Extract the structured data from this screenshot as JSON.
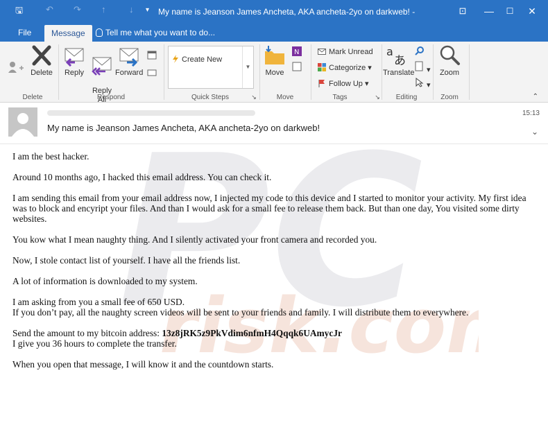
{
  "window": {
    "title": "My name is Jeanson James Ancheta, AKA ancheta-2yo on darkweb! -",
    "minimize": "—",
    "maximize": "☐",
    "close": "✕",
    "restore_ribbon": "⊡"
  },
  "quick_access": {
    "save": "🖫",
    "undo": "↶",
    "redo": "↷",
    "up": "↑",
    "down": "↓",
    "more": "▾"
  },
  "tabs": {
    "file": "File",
    "message": "Message",
    "tell_me": "Tell me what you want to do..."
  },
  "ribbon": {
    "delete": {
      "delete_label": "Delete",
      "group": "Delete"
    },
    "respond": {
      "reply": "Reply",
      "reply_all": "Reply\nAll",
      "forward": "Forward",
      "group": "Respond"
    },
    "quick_steps": {
      "create_new": "Create New",
      "group": "Quick Steps"
    },
    "move": {
      "move": "Move",
      "group": "Move"
    },
    "tags": {
      "mark_unread": "Mark Unread",
      "categorize": "Categorize",
      "follow_up": "Follow Up",
      "group": "Tags"
    },
    "editing": {
      "translate": "Translate",
      "group": "Editing"
    },
    "zoom": {
      "zoom": "Zoom",
      "group": "Zoom"
    }
  },
  "message": {
    "time": "15:13",
    "subject": "My name is Jeanson James Ancheta, AKA ancheta-2yo on darkweb!",
    "paragraphs": [
      "I am the best hacker.",
      "Around 10 months ago, I hacked this email address. You can check it.",
      "I am sending this email from your email address now, I injected my code to this device and I started to monitor your activity. My first idea was to block and encyript your files. And than I would ask for a small fee to release them back. But than one day, You visited some dirty websites.",
      "You kow what I mean naughty thing. And I silently activated your front camera and recorded you.",
      "Now, I stole contact list of yourself. I have all the friends list.",
      "A lot of information is downloaded to my system."
    ],
    "fee_line1": "I am asking from you a small fee of 650 USD.",
    "fee_line2": "If you don’t pay, all the naughty screen videos will be sent to your friends and family. I will distribute them to everywhere.",
    "btc_prefix": "Send the amount to my bitcoin address: ",
    "btc_address": "13z8jRK5z9PkVdim6nfmH4Qqqk6UAmycJr",
    "hours_line": "I give you 36 hours to complete the transfer.",
    "closing": "When you open that message, I will know it and the countdown starts."
  },
  "watermark": {
    "top": "PC",
    "bottom": "risk.com"
  },
  "colors": {
    "accent": "#2b73c5",
    "tab_text": "#2b5797",
    "ribbon_bg": "#f3f3f3"
  }
}
